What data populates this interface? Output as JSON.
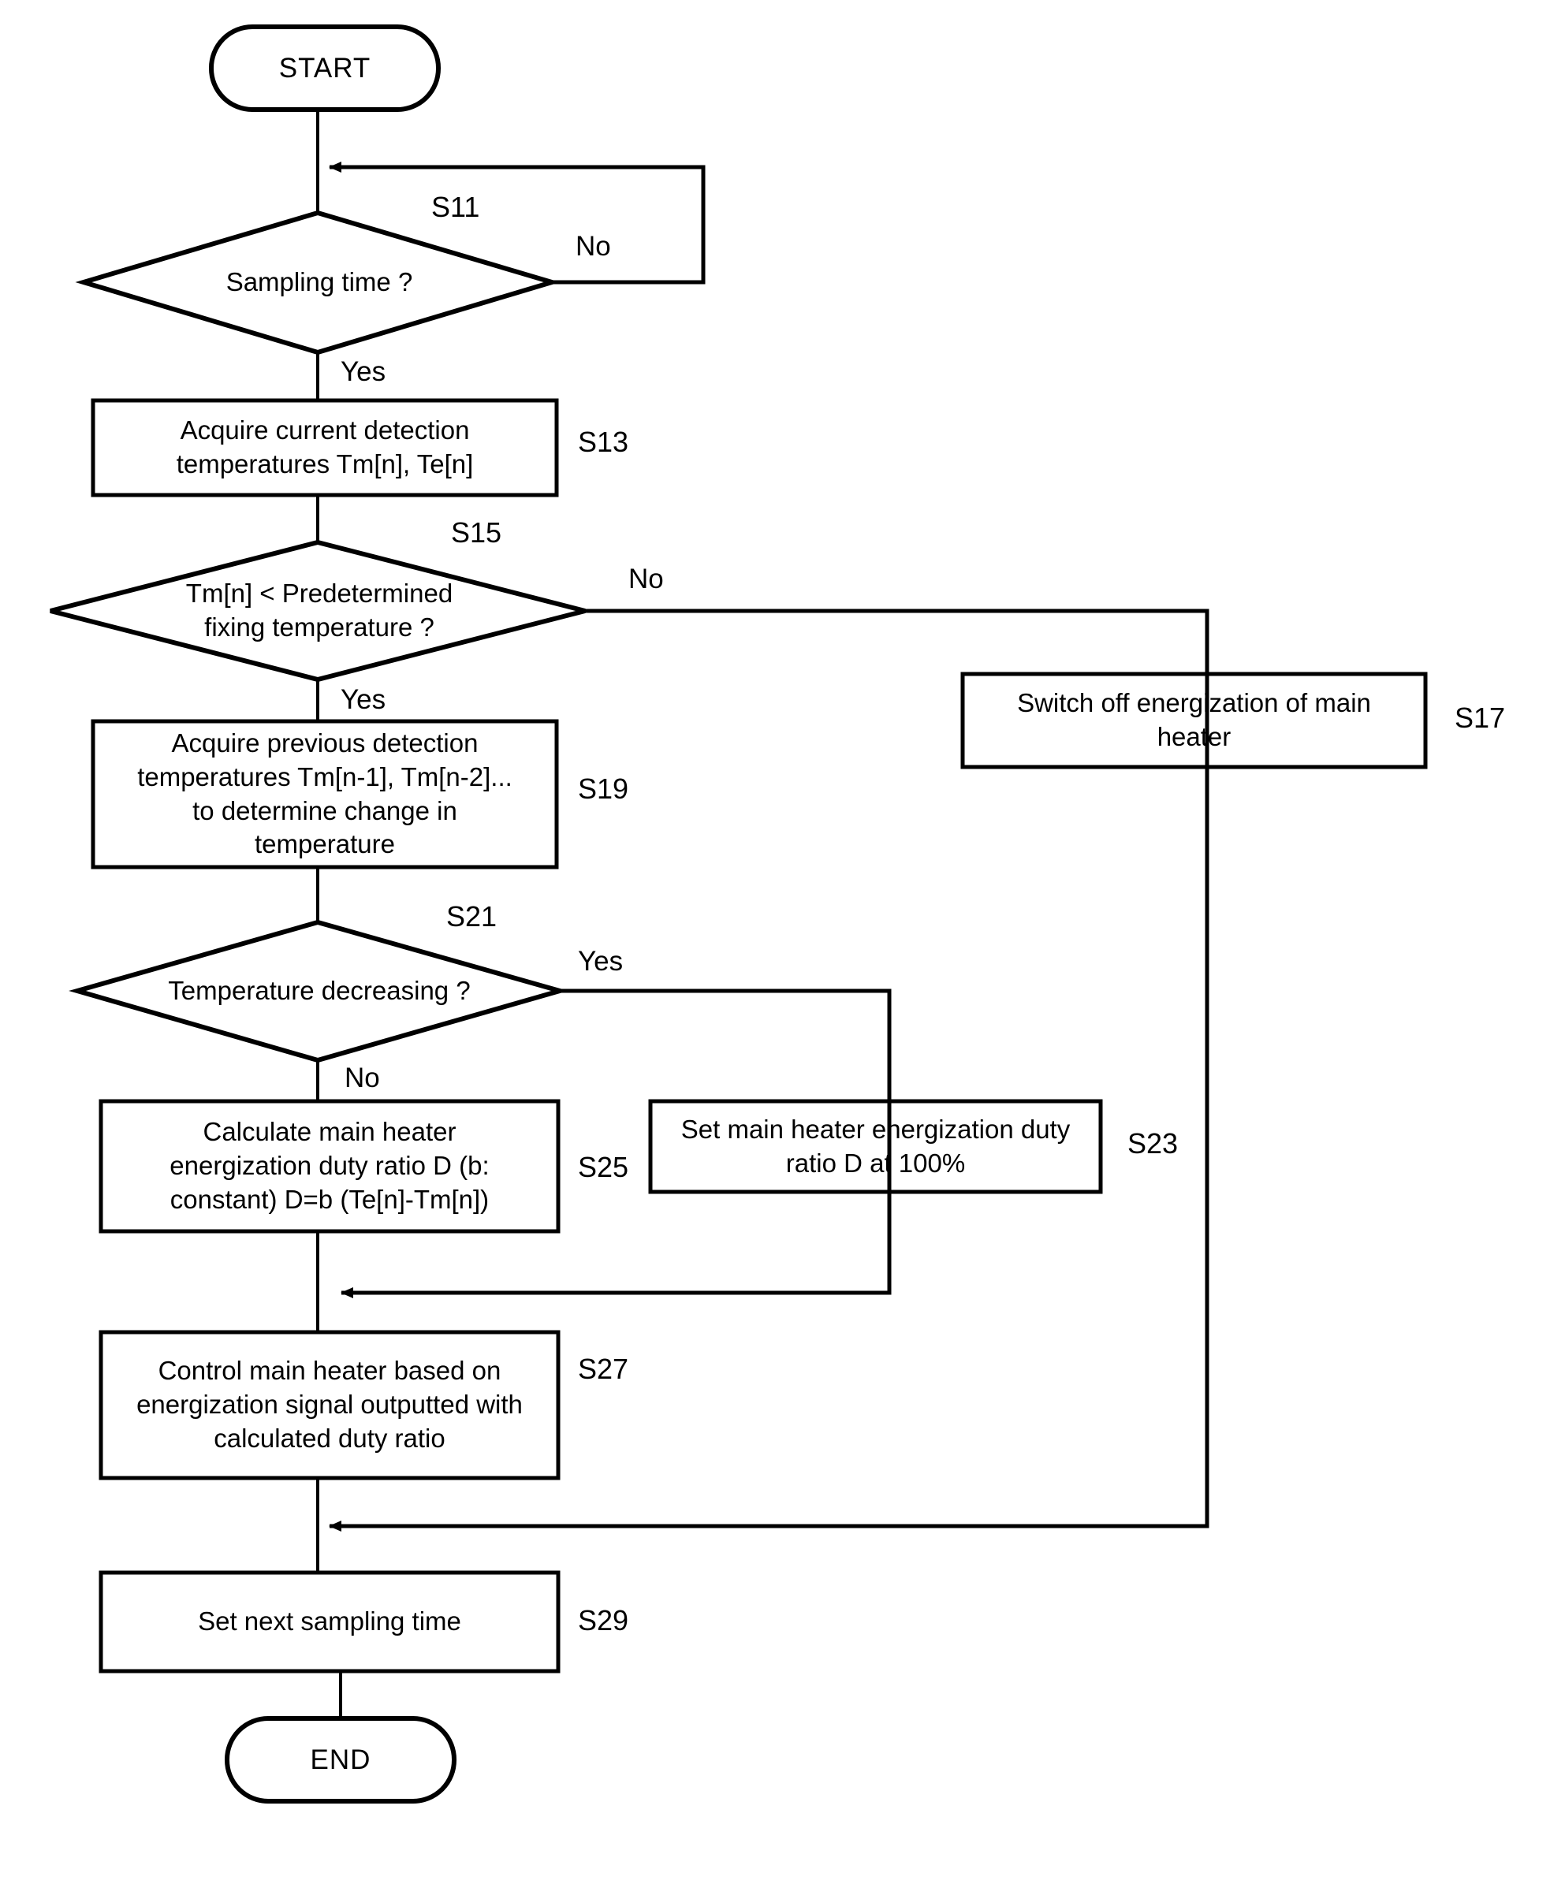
{
  "diagram": {
    "type": "flowchart",
    "title": "Main heater energization control flowchart",
    "nodes": {
      "start": {
        "kind": "terminator",
        "text": "START"
      },
      "s11": {
        "kind": "decision",
        "text": "Sampling time ?",
        "step": "S11"
      },
      "s13": {
        "kind": "process",
        "text": "Acquire current detection\ntemperatures Tm[n], Te[n]",
        "step": "S13"
      },
      "s15": {
        "kind": "decision",
        "text": "Tm[n] < Predetermined\nfixing temperature ?",
        "step": "S15"
      },
      "s17": {
        "kind": "process",
        "text": "Switch off energization of main\nheater",
        "step": "S17"
      },
      "s19": {
        "kind": "process",
        "text": "Acquire previous detection\ntemperatures Tm[n-1], Tm[n-2]...\nto determine change in\ntemperature",
        "step": "S19"
      },
      "s21": {
        "kind": "decision",
        "text": "Temperature decreasing ?",
        "step": "S21"
      },
      "s23": {
        "kind": "process",
        "text": "Set main heater energization duty\nratio D at 100%",
        "step": "S23"
      },
      "s25": {
        "kind": "process",
        "text": "Calculate main heater\nenergization duty ratio D (b:\nconstant) D=b (Te[n]-Tm[n])",
        "step": "S25"
      },
      "s27": {
        "kind": "process",
        "text": "Control main heater based on\nenergization signal outputted with\ncalculated duty ratio",
        "step": "S27"
      },
      "s29": {
        "kind": "process",
        "text": "Set next sampling time",
        "step": "S29"
      },
      "end": {
        "kind": "terminator",
        "text": "END"
      }
    },
    "edge_labels": {
      "s11_no": "No",
      "s11_yes": "Yes",
      "s15_no": "No",
      "s15_yes": "Yes",
      "s21_yes": "Yes",
      "s21_no": "No"
    },
    "colors": {
      "stroke": "#000000",
      "fill": "#ffffff",
      "text": "#000000"
    }
  }
}
